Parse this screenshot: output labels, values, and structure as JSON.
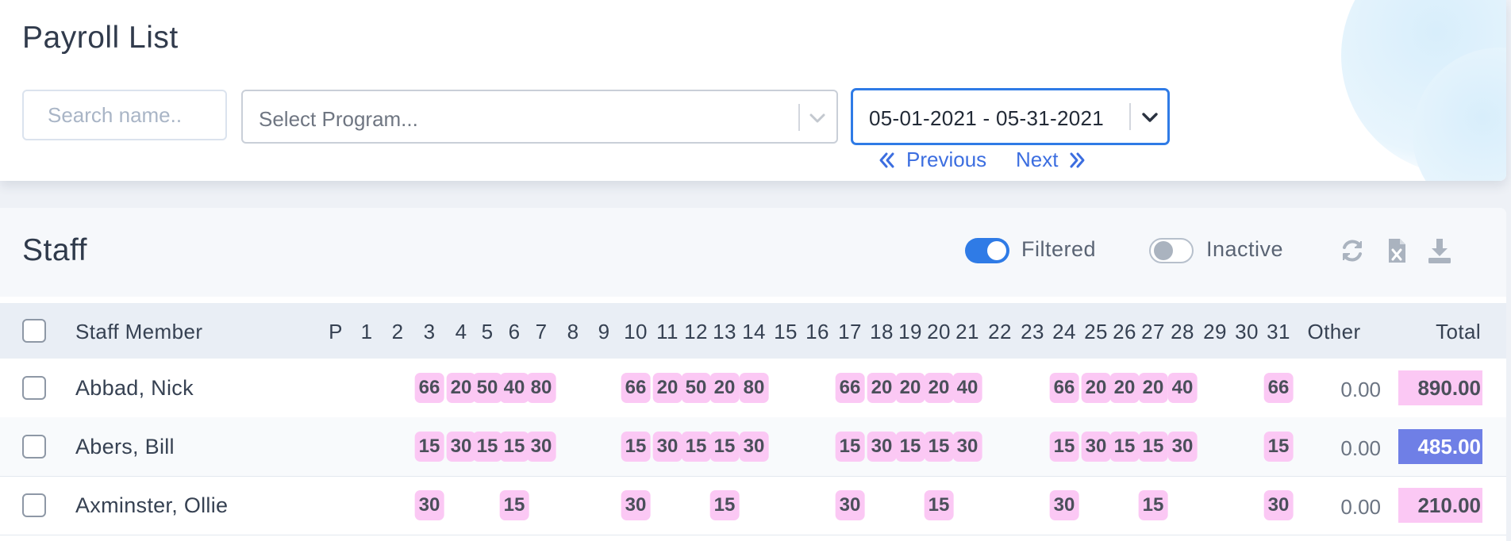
{
  "header": {
    "title": "Payroll List",
    "search_placeholder": "Search name..",
    "program_placeholder": "Select Program...",
    "date_range": "05-01-2021 - 05-31-2021",
    "previous_label": "Previous",
    "next_label": "Next"
  },
  "staff": {
    "title": "Staff",
    "filtered_label": "Filtered",
    "filtered_on": true,
    "inactive_label": "Inactive",
    "inactive_on": false,
    "icons": [
      "refresh-icon",
      "excel-export-icon",
      "download-icon"
    ],
    "columns": {
      "name": "Staff Member",
      "days": [
        "P",
        "1",
        "2",
        "3",
        "4",
        "5",
        "6",
        "7",
        "8",
        "9",
        "10",
        "11",
        "12",
        "13",
        "14",
        "15",
        "16",
        "17",
        "18",
        "19",
        "20",
        "21",
        "22",
        "23",
        "24",
        "25",
        "26",
        "27",
        "28",
        "29",
        "30",
        "31"
      ],
      "other": "Other",
      "total": "Total"
    },
    "rows": [
      {
        "name": "Abbad, Nick",
        "values": {
          "3": "66",
          "4": "20",
          "5": "50",
          "6": "40",
          "7": "80",
          "10": "66",
          "11": "20",
          "12": "50",
          "13": "20",
          "14": "80",
          "17": "66",
          "18": "20",
          "19": "20",
          "20": "20",
          "21": "40",
          "24": "66",
          "25": "20",
          "26": "20",
          "27": "20",
          "28": "40",
          "31": "66"
        },
        "other": "0.00",
        "total": "890.00",
        "total_style": "pink"
      },
      {
        "name": "Abers, Bill",
        "values": {
          "3": "15",
          "4": "30",
          "5": "15",
          "6": "15",
          "7": "30",
          "10": "15",
          "11": "30",
          "12": "15",
          "13": "15",
          "14": "30",
          "17": "15",
          "18": "30",
          "19": "15",
          "20": "15",
          "21": "30",
          "24": "15",
          "25": "30",
          "26": "15",
          "27": "15",
          "28": "30",
          "31": "15"
        },
        "other": "0.00",
        "total": "485.00",
        "total_style": "blue"
      },
      {
        "name": "Axminster, Ollie",
        "values": {
          "3": "30",
          "6": "15",
          "10": "30",
          "13": "15",
          "17": "30",
          "20": "15",
          "24": "30",
          "27": "15",
          "31": "30"
        },
        "other": "0.00",
        "total": "210.00",
        "total_style": "pink"
      }
    ]
  },
  "colors": {
    "accent": "#2f7be6",
    "link": "#3c6ee0",
    "pill": "#fbc8f4",
    "total_blue": "#6f7fe6",
    "total_pink": "#fbc8f4"
  }
}
